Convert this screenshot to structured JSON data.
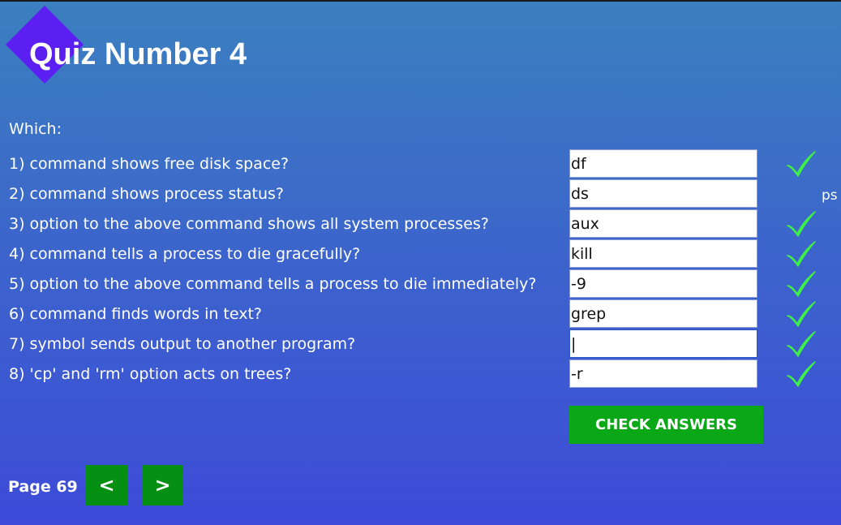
{
  "header": {
    "title": "Quiz Number 4"
  },
  "quiz": {
    "intro": "Which:",
    "questions": [
      {
        "label": "1) command shows free disk space?",
        "answer": "df",
        "status": "correct"
      },
      {
        "label": "2) command shows process status?",
        "answer": "ds",
        "status": "incorrect",
        "correction": "ps"
      },
      {
        "label": "3) option to the above command shows all system processes?",
        "answer": "aux",
        "status": "correct"
      },
      {
        "label": "4) command tells a process to die gracefully?",
        "answer": "kill",
        "status": "correct"
      },
      {
        "label": "5) option to the above command tells a process to die immediately?",
        "answer": "-9",
        "status": "correct"
      },
      {
        "label": "6) command finds words in text?",
        "answer": "grep",
        "status": "correct"
      },
      {
        "label": "7) symbol sends output to another program?",
        "answer": "|",
        "status": "correct"
      },
      {
        "label": "8) 'cp' and 'rm' option acts on trees?",
        "answer": "-r",
        "status": "correct"
      }
    ],
    "check_button_label": "CHECK ANSWERS",
    "check_icon": "checkmark-icon"
  },
  "footer": {
    "page_label": "Page 69",
    "prev_label": "<",
    "next_label": ">"
  },
  "colors": {
    "background_top": "#3b80bf",
    "background_bottom": "#3d4bd8",
    "logo_diamond": "#5b1ff2",
    "check_button": "#0aa817",
    "nav_button": "#058f13",
    "checkmark": "#3ef046"
  }
}
